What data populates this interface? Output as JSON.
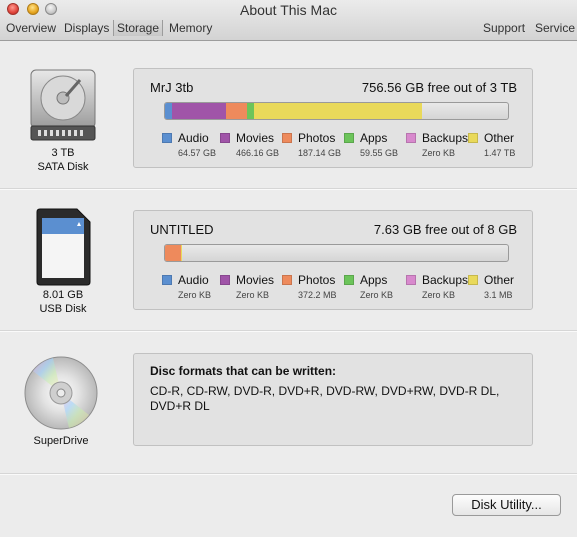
{
  "window": {
    "title": "About This Mac",
    "tabs": [
      "Overview",
      "Displays",
      "Storage",
      "Memory"
    ],
    "right_links": [
      "Support",
      "Service"
    ]
  },
  "devices": [
    {
      "label_line1": "3 TB",
      "label_line2": "SATA Disk",
      "icon": "hard-disk-icon",
      "volume_name": "MrJ 3tb",
      "free_text": "756.56 GB free out of 3 TB",
      "usage": [
        {
          "name": "Audio",
          "size": "64.57 GB",
          "color": "#5b8fd0",
          "fraction": 0.0215
        },
        {
          "name": "Movies",
          "size": "466.16 GB",
          "color": "#a054a8",
          "fraction": 0.1554
        },
        {
          "name": "Photos",
          "size": "187.14 GB",
          "color": "#ee8a5c",
          "fraction": 0.0624
        },
        {
          "name": "Apps",
          "size": "59.55 GB",
          "color": "#6cc45a",
          "fraction": 0.0199
        },
        {
          "name": "Backups",
          "size": "Zero KB",
          "color": "#d889cd",
          "fraction": 0
        },
        {
          "name": "Other",
          "size": "1.47 TB",
          "color": "#e9d95a",
          "fraction": 0.49
        }
      ]
    },
    {
      "label_line1": "8.01 GB",
      "label_line2": "USB Disk",
      "icon": "sd-card-icon",
      "volume_name": "UNTITLED",
      "free_text": "7.63 GB free out of 8 GB",
      "usage": [
        {
          "name": "Audio",
          "size": "Zero KB",
          "color": "#5b8fd0",
          "fraction": 0
        },
        {
          "name": "Movies",
          "size": "Zero KB",
          "color": "#a054a8",
          "fraction": 0
        },
        {
          "name": "Photos",
          "size": "372.2 MB",
          "color": "#ee8a5c",
          "fraction": 0.0465
        },
        {
          "name": "Apps",
          "size": "Zero KB",
          "color": "#6cc45a",
          "fraction": 0
        },
        {
          "name": "Backups",
          "size": "Zero KB",
          "color": "#d889cd",
          "fraction": 0
        },
        {
          "name": "Other",
          "size": "3.1 MB",
          "color": "#e9d95a",
          "fraction": 0.0004
        }
      ]
    }
  ],
  "superdrive": {
    "label": "SuperDrive",
    "icon": "optical-disc-icon",
    "title": "Disc formats that can be written:",
    "formats": "CD-R, CD-RW, DVD-R, DVD+R, DVD-RW, DVD+RW, DVD-R DL, DVD+R DL"
  },
  "disk_utility_button": "Disk Utility..."
}
